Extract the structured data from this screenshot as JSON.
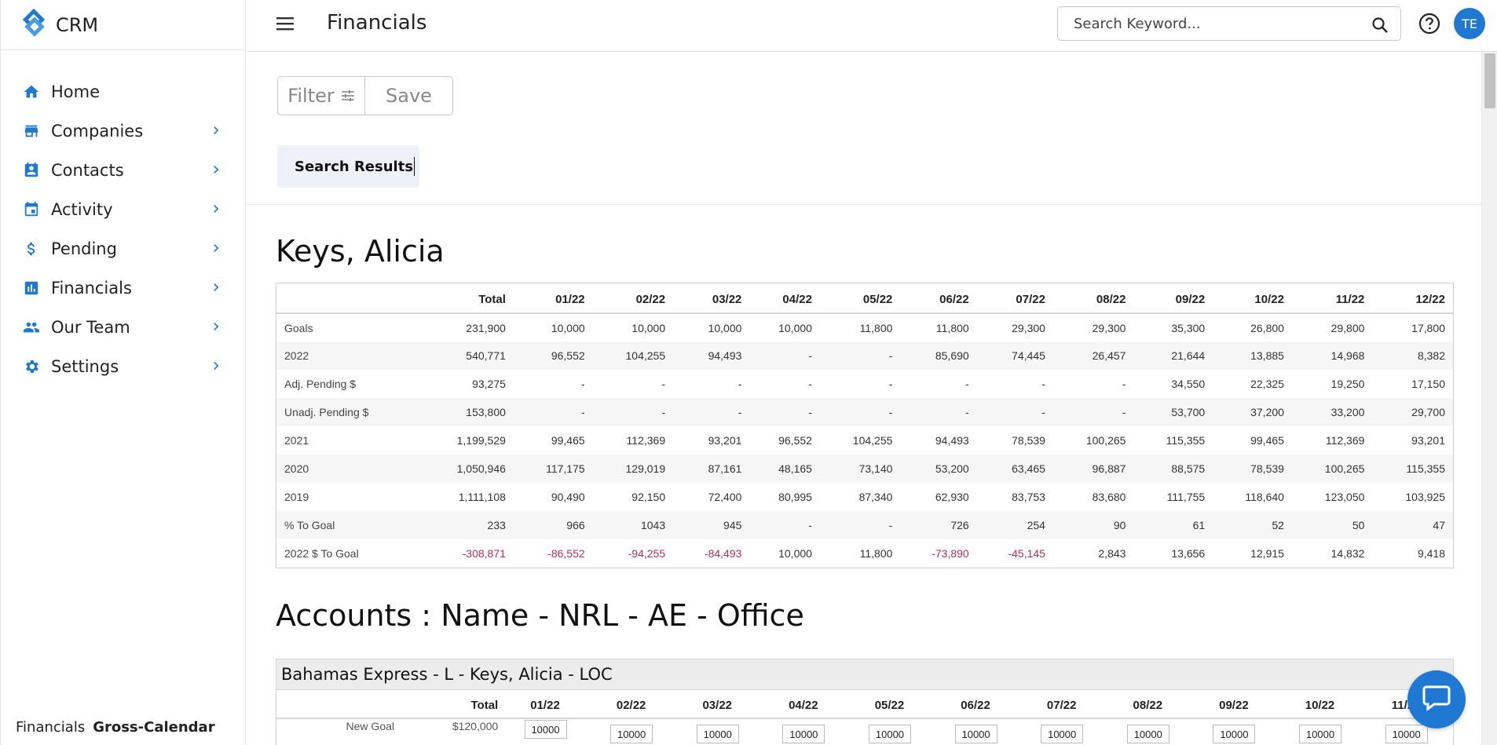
{
  "brand": {
    "name": "CRM"
  },
  "header": {
    "title": "Financials",
    "search_placeholder": "Search Keyword...",
    "avatar_initials": "TE"
  },
  "sidebar": {
    "items": [
      {
        "label": "Home",
        "icon": "home-icon"
      },
      {
        "label": "Companies",
        "icon": "store-icon"
      },
      {
        "label": "Contacts",
        "icon": "contact-card-icon"
      },
      {
        "label": "Activity",
        "icon": "calendar-icon"
      },
      {
        "label": "Pending",
        "icon": "dollar-icon"
      },
      {
        "label": "Financials",
        "icon": "bar-chart-icon"
      },
      {
        "label": "Our Team",
        "icon": "people-icon"
      },
      {
        "label": "Settings",
        "icon": "gear-icon"
      }
    ],
    "footer": {
      "section": "Financials",
      "view": "Gross-Calendar"
    }
  },
  "toolbar": {
    "filter_label": "Filter",
    "save_label": "Save"
  },
  "results_tab": {
    "label": "Search Results"
  },
  "person": {
    "name": "Keys, Alicia",
    "columns": [
      "",
      "Total",
      "01/22",
      "02/22",
      "03/22",
      "04/22",
      "05/22",
      "06/22",
      "07/22",
      "08/22",
      "09/22",
      "10/22",
      "11/22",
      "12/22"
    ],
    "rows": [
      {
        "label": "Goals",
        "values": [
          "231,900",
          "10,000",
          "10,000",
          "10,000",
          "10,000",
          "11,800",
          "11,800",
          "29,300",
          "29,300",
          "35,300",
          "26,800",
          "29,800",
          "17,800"
        ]
      },
      {
        "label": "2022",
        "values": [
          "540,771",
          "96,552",
          "104,255",
          "94,493",
          "-",
          "-",
          "85,690",
          "74,445",
          "26,457",
          "21,644",
          "13,885",
          "14,968",
          "8,382"
        ]
      },
      {
        "label": "Adj. Pending $",
        "values": [
          "93,275",
          "-",
          "-",
          "-",
          "-",
          "-",
          "-",
          "-",
          "-",
          "34,550",
          "22,325",
          "19,250",
          "17,150"
        ]
      },
      {
        "label": "Unadj. Pending $",
        "values": [
          "153,800",
          "-",
          "-",
          "-",
          "-",
          "-",
          "-",
          "-",
          "-",
          "53,700",
          "37,200",
          "33,200",
          "29,700"
        ]
      },
      {
        "label": "2021",
        "values": [
          "1,199,529",
          "99,465",
          "112,369",
          "93,201",
          "96,552",
          "104,255",
          "94,493",
          "78,539",
          "100,265",
          "115,355",
          "99,465",
          "112,369",
          "93,201"
        ]
      },
      {
        "label": "2020",
        "values": [
          "1,050,946",
          "117,175",
          "129,019",
          "87,161",
          "48,165",
          "73,140",
          "53,200",
          "63,465",
          "96,887",
          "88,575",
          "78,539",
          "100,265",
          "115,355"
        ]
      },
      {
        "label": "2019",
        "values": [
          "1,111,108",
          "90,490",
          "92,150",
          "72,400",
          "80,995",
          "87,340",
          "62,930",
          "83,753",
          "83,680",
          "111,755",
          "118,640",
          "123,050",
          "103,925"
        ]
      },
      {
        "label": "% To Goal",
        "values": [
          "233",
          "966",
          "1043",
          "945",
          "-",
          "-",
          "726",
          "254",
          "90",
          "61",
          "52",
          "50",
          "47"
        ]
      },
      {
        "label": "2022 $ To Goal",
        "values": [
          "-308,871",
          "-86,552",
          "-94,255",
          "-84,493",
          "10,000",
          "11,800",
          "-73,890",
          "-45,145",
          "2,843",
          "13,656",
          "12,915",
          "14,832",
          "9,418"
        ]
      }
    ]
  },
  "accounts": {
    "title": "Accounts : Name - NRL - AE - Office",
    "account_header": "Bahamas Express  -  L  -  Keys, Alicia  -  LOC",
    "columns": [
      "",
      "Total",
      "01/22",
      "02/22",
      "03/22",
      "04/22",
      "05/22",
      "06/22",
      "07/22",
      "08/22",
      "09/22",
      "10/22",
      "11/22"
    ],
    "row_label": "New Goal",
    "row_total": "$120,000",
    "goal_inputs": [
      "10000",
      "10000",
      "10000",
      "10000",
      "10000",
      "10000",
      "10000",
      "10000",
      "10000",
      "10000",
      "10000",
      "10000"
    ]
  },
  "colors": {
    "accent": "#1f78d1",
    "negative": "#b0315e"
  }
}
